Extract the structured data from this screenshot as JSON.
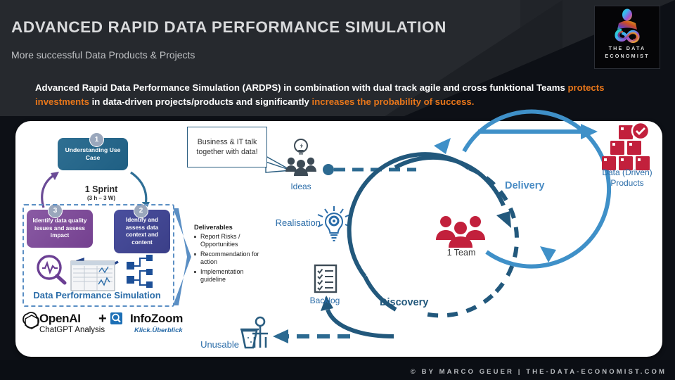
{
  "header": {
    "title": "ADVANCED RAPID DATA PERFORMANCE SIMULATION",
    "subtitle": "More successful Data Products & Projects",
    "logo": {
      "line1": "THE DATA",
      "line2": "ECONOMIST"
    }
  },
  "lead": {
    "part1": "Advanced Rapid Data Performance Simulation (ARDPS) in combination with dual track agile and cross funktional Teams ",
    "highlight1": "protects investments",
    "part2": " in data-driven projects/products and significantly ",
    "highlight2": "increases the probability of success.",
    "highlight_color": "#e8761a"
  },
  "sprint": {
    "step1": {
      "number": "1",
      "label": "Understanding Use Case",
      "color": "#26678b"
    },
    "step2": {
      "number": "2",
      "label": "Identify and assess data context and content",
      "color": "#41459a"
    },
    "step3": {
      "number": "3",
      "label": "Identify data quality issues and assess impact",
      "color": "#7e4d9b"
    },
    "cycle_title": "1 Sprint",
    "cycle_duration": "(3 h – 3 W)",
    "dashed_box_label": "Data Performance Simulation"
  },
  "tools": {
    "openai_name": "OpenAI",
    "openai_sub": "ChatGPT Analysis",
    "plus": "+",
    "infozoom_name": "InfoZoom",
    "infozoom_sub": "Klick.Überblick"
  },
  "callout": {
    "text": "Business & IT talk together with data!"
  },
  "deliverables": {
    "title": "Deliverables",
    "items": [
      "Report Risks / Opportunities",
      "Recommendation for action",
      "Implementation guideline"
    ]
  },
  "flow": {
    "ideas": "Ideas",
    "realisation": "Realisation",
    "backlog": "Backlog",
    "unusable": "Unusable",
    "delivery": "Delivery",
    "discovery": "Discovery",
    "team": "1 Team",
    "products": "Data (Driven) Products"
  },
  "colors": {
    "delivery_blue": "#4a8cc4",
    "discovery_blue": "#22587c",
    "accent_orange": "#e8761a",
    "red": "#c2203c",
    "label_blue": "#2a6ca8"
  },
  "footer": {
    "text": "© BY MARCO GEUER | THE-DATA-ECONOMIST.COM"
  }
}
